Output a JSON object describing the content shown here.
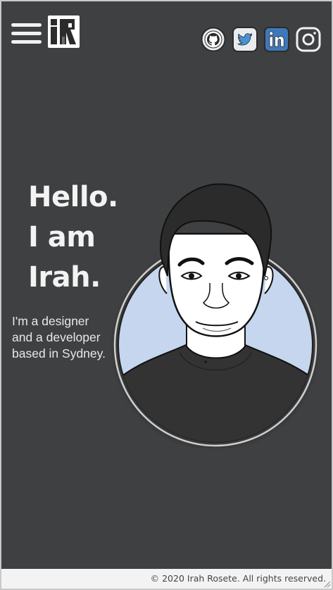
{
  "header": {
    "menu_icon": "hamburger-menu-icon",
    "logo_icon": "ir-logo",
    "social_icons": [
      "github-icon",
      "twitter-icon",
      "linkedin-icon",
      "instagram-icon"
    ]
  },
  "hero": {
    "headline": [
      "Hello.",
      "I am",
      "Irah."
    ],
    "intro": [
      "I'm a designer",
      "and a developer",
      "based in Sydney."
    ],
    "portrait_icon": "portrait-illustration"
  },
  "footer": {
    "copyright": "© 2020 Irah Rosete. All rights reserved."
  },
  "colors": {
    "background": "#3e4042",
    "text": "#f3f3f3",
    "portrait_circle": "#c5d6ee",
    "footer_bg": "#f3f3f3",
    "linkedin_blue": "#3f78b8",
    "twitter_blue": "#4a90d4"
  }
}
